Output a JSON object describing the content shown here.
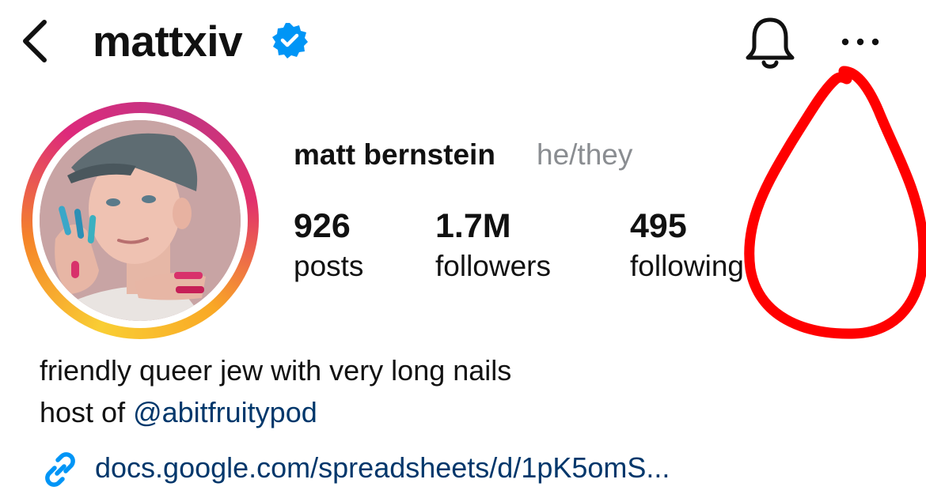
{
  "header": {
    "username": "mattxiv",
    "verified": true,
    "icons": [
      "back-chevron-icon",
      "verified-badge-icon",
      "bell-icon",
      "more-options-icon"
    ]
  },
  "profile": {
    "display_name": "matt bernstein",
    "pronouns": "he/they",
    "stats": {
      "posts": {
        "value": "926",
        "label": "posts"
      },
      "followers": {
        "value": "1.7M",
        "label": "followers"
      },
      "following": {
        "value": "495",
        "label": "following"
      }
    }
  },
  "bio": {
    "line1": "friendly queer jew with very long nails",
    "host_prefix": "host of ",
    "mention": "@abitfruitypod",
    "link": "docs.google.com/spreadsheets/d/1pK5omS...",
    "link_icon": "link-icon"
  },
  "colors": {
    "link_blue": "#00376b",
    "verified_blue": "#0095f6",
    "pronoun_gray": "#8a8d91",
    "annotation_red": "#ff0000"
  }
}
